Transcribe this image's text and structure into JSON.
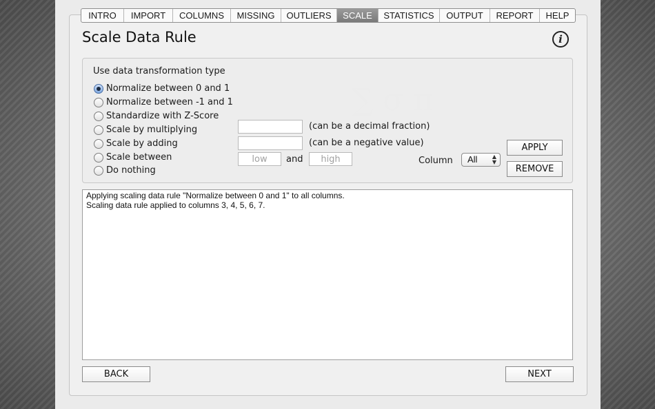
{
  "tabs": [
    {
      "label": "INTRO",
      "active": false
    },
    {
      "label": "IMPORT",
      "active": false
    },
    {
      "label": "COLUMNS",
      "active": false
    },
    {
      "label": "MISSING",
      "active": false
    },
    {
      "label": "OUTLIERS",
      "active": false
    },
    {
      "label": "SCALE",
      "active": true
    },
    {
      "label": "STATISTICS",
      "active": false
    },
    {
      "label": "OUTPUT",
      "active": false
    },
    {
      "label": "REPORT",
      "active": false
    },
    {
      "label": "HELP",
      "active": false
    }
  ],
  "page": {
    "title": "Scale Data Rule",
    "info_icon": "i"
  },
  "rule": {
    "group_label": "Use data transformation type",
    "options": [
      {
        "label": "Normalize between 0 and 1",
        "selected": true
      },
      {
        "label": "Normalize between -1 and 1",
        "selected": false
      },
      {
        "label": "Standardize with Z-Score",
        "selected": false
      },
      {
        "label": "Scale by multiplying",
        "selected": false
      },
      {
        "label": "Scale by adding",
        "selected": false
      },
      {
        "label": "Scale between",
        "selected": false
      },
      {
        "label": "Do nothing",
        "selected": false
      }
    ],
    "multiply_value": "",
    "multiply_hint": "(can be a decimal fraction)",
    "add_value": "",
    "add_hint": "(can be a negative value)",
    "low_placeholder": "low",
    "and_label": "and",
    "high_placeholder": "high",
    "column_label": "Column",
    "column_value": "All",
    "apply_label": "APPLY",
    "remove_label": "REMOVE"
  },
  "log": {
    "lines": [
      "Applying scaling data rule \"Normalize between 0 and 1\" to all columns.",
      "Scaling data rule applied to columns 3, 4, 5, 6, 7."
    ]
  },
  "nav": {
    "back_label": "BACK",
    "next_label": "NEXT"
  },
  "colors": {
    "active_tab": "#8a8a8a",
    "panel": "#ebebeb",
    "radio_selected": "#7fa9e0"
  }
}
